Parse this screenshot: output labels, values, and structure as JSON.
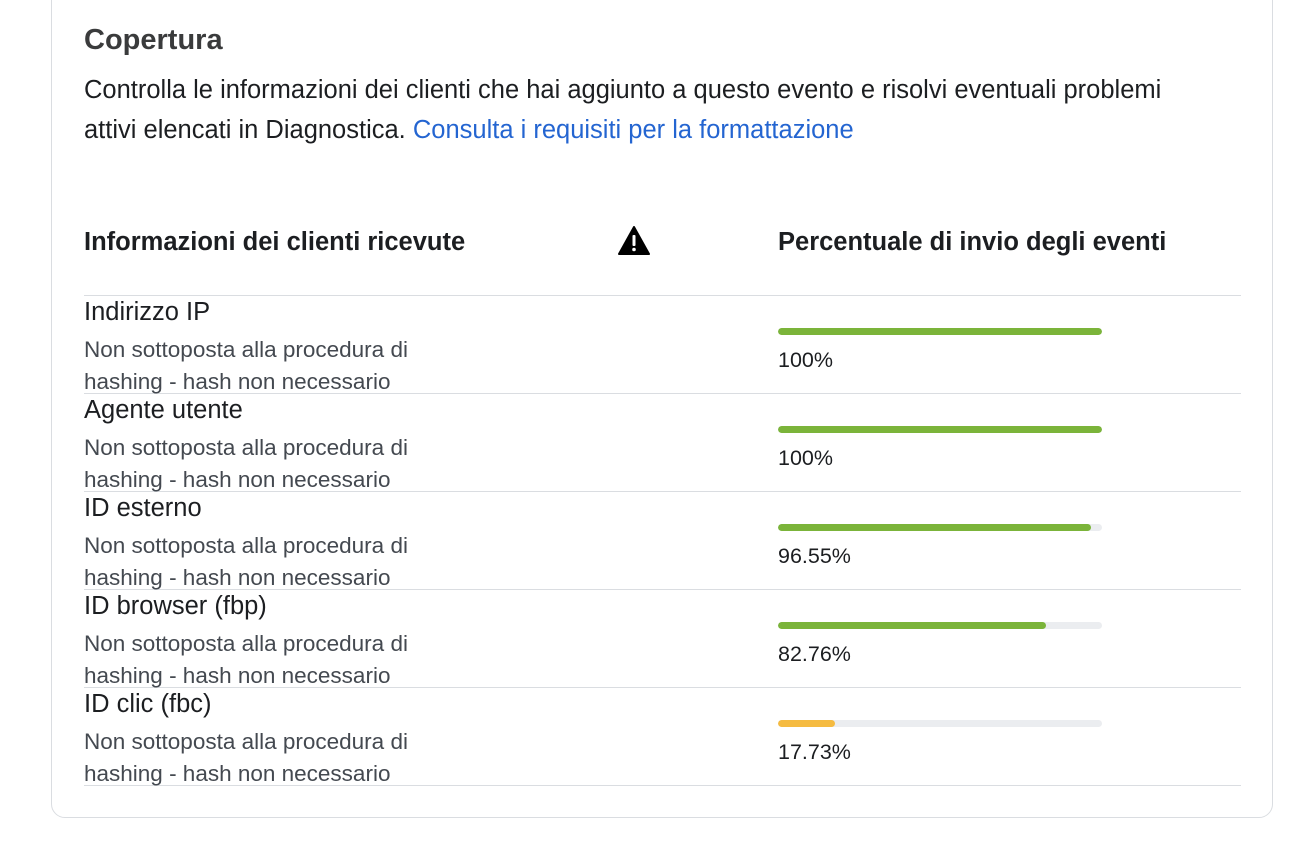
{
  "header": {
    "title": "Copertura",
    "description": "Controlla le informazioni dei clienti che hai aggiunto a questo evento e risolvi eventuali problemi attivi elencati in Diagnostica.",
    "link_label": "Consulta i requisiti per la formattazione"
  },
  "table": {
    "col_left": "Informazioni dei clienti ricevute",
    "col_right": "Percentuale di invio degli eventi",
    "warning_icon": "warning-triangle-icon",
    "rows": [
      {
        "name": "Indirizzo IP",
        "sub": "Non sottoposta alla procedura di hashing - hash non necessario",
        "pct_label": "100%",
        "value": 100,
        "color": "#7bb43a"
      },
      {
        "name": "Agente utente",
        "sub": "Non sottoposta alla procedura di hashing - hash non necessario",
        "pct_label": "100%",
        "value": 100,
        "color": "#7bb43a"
      },
      {
        "name": "ID esterno",
        "sub": "Non sottoposta alla procedura di hashing - hash non necessario",
        "pct_label": "96.55%",
        "value": 96.55,
        "color": "#7bb43a"
      },
      {
        "name": "ID browser (fbp)",
        "sub": "Non sottoposta alla procedura di hashing - hash non necessario",
        "pct_label": "82.76%",
        "value": 82.76,
        "color": "#7bb43a"
      },
      {
        "name": "ID clic (fbc)",
        "sub": "Non sottoposta alla procedura di hashing - hash non necessario",
        "pct_label": "17.73%",
        "value": 17.73,
        "color": "#f5bb41"
      }
    ]
  }
}
